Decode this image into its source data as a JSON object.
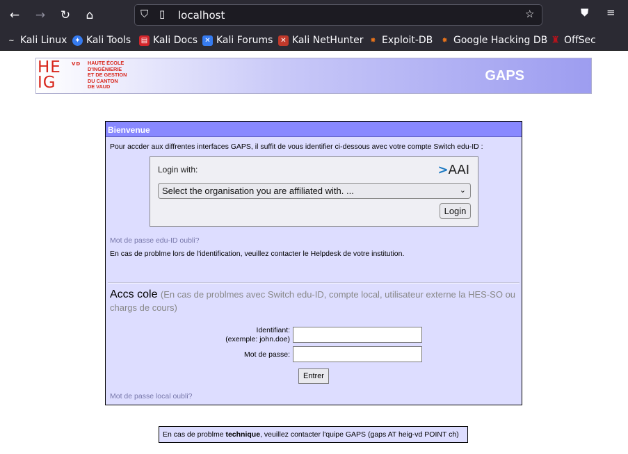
{
  "browser": {
    "url": "localhost",
    "nav": {
      "back_icon": "back-arrow-icon",
      "forward_icon": "forward-arrow-icon",
      "reload_icon": "reload-icon",
      "home_icon": "home-icon"
    },
    "bookmarks": [
      {
        "label": "Kali Linux",
        "icon": "kali-dragon-icon",
        "color": "#3a3a3a"
      },
      {
        "label": "Kali Tools",
        "icon": "kali-tools-icon",
        "color": "#367bf0"
      },
      {
        "label": "Kali Docs",
        "icon": "kali-docs-icon",
        "color": "#d3252b"
      },
      {
        "label": "Kali Forums",
        "icon": "kali-forums-icon",
        "color": "#367bf0"
      },
      {
        "label": "Kali NetHunter",
        "icon": "nethunter-icon",
        "color": "#c0392b"
      },
      {
        "label": "Exploit-DB",
        "icon": "exploitdb-icon",
        "color": "#e8731a"
      },
      {
        "label": "Google Hacking DB",
        "icon": "ghdb-icon",
        "color": "#e8731a"
      },
      {
        "label": "OffSec",
        "icon": "offsec-icon",
        "color": "#b8121b"
      }
    ]
  },
  "header": {
    "logo_letters_top": "HE",
    "logo_letters_bottom": "IG",
    "logo_vd": "VD",
    "logo_text": "HAUTE ÉCOLE\nD'INGÉNIERIE\nET DE GESTION\nDU CANTON\nDE VAUD",
    "title": "GAPS"
  },
  "panel": {
    "heading": "Bienvenue",
    "intro": "Pour accder aux diffrentes interfaces GAPS, il suffit de vous identifier ci-dessous avec votre compte Switch edu-ID :",
    "aai": {
      "login_with": "Login with:",
      "logo_arrow": ">",
      "logo_text": "AAI",
      "select_value": "Select the organisation you are affiliated with. ...",
      "login_button": "Login"
    },
    "forgot_eduid": "Mot de passe edu-ID oubli?",
    "problem_note": "En cas de problme lors de l'identification, veuillez contacter le Helpdesk de votre institution.",
    "local": {
      "heading": "Accs cole",
      "subheading": "(En cas de problmes avec Switch edu-ID, compte local, utilisateur externe la HES-SO ou chargs de cours)",
      "id_label_line1": "Identifiant:",
      "id_label_line2": "(exemple: john.doe)",
      "id_value": "",
      "password_label": "Mot de passe:",
      "password_value": "",
      "submit_button": "Entrer",
      "forgot_local": "Mot de passe local oubli?"
    }
  },
  "footer": {
    "prefix": "En cas de problme ",
    "emphasis": "technique",
    "suffix": ", veuillez contacter l'quipe GAPS (gaps AT heig-vd POINT ch)"
  },
  "colors": {
    "panel_bg": "#ddddff",
    "panel_header": "#8888ff",
    "link": "#7777aa",
    "logo_red": "#d8281e"
  }
}
